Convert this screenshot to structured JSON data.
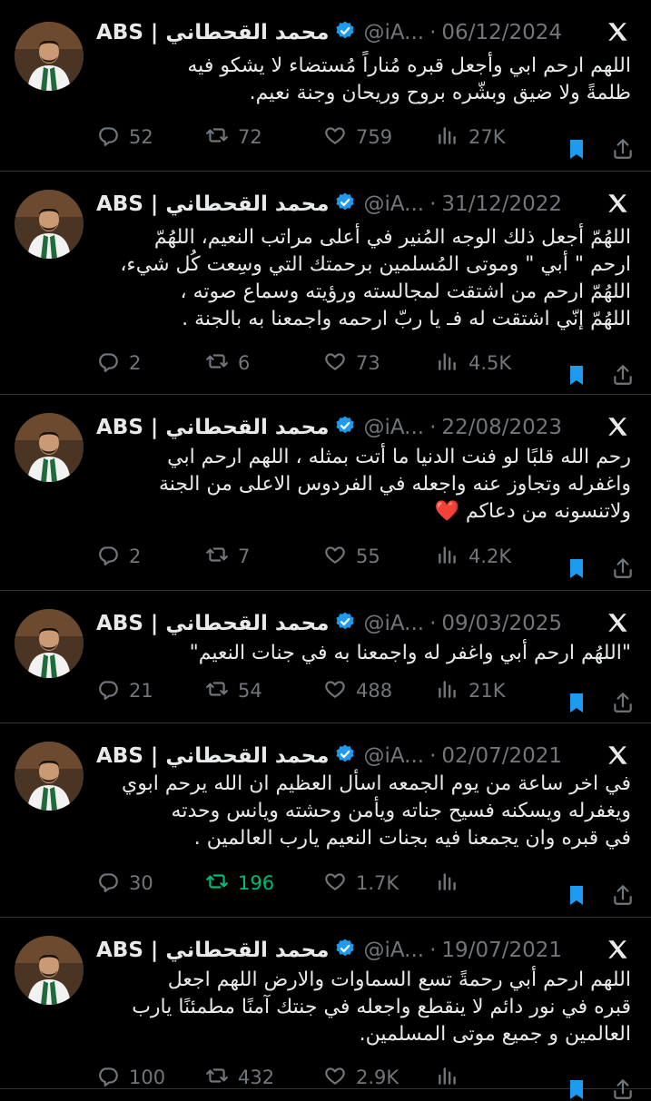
{
  "tweets": [
    {
      "name": "ABS | محمد القحطاني",
      "handle": "@iA...",
      "date": "06/12/2024",
      "lines": [
        "اللهم ارحم ابي وأجعل قبره مُناراً مُستضاء لا يشكو فيه",
        "ظلمةً ولا ضيق وبشّره بروح وريحان وجنة نعيم."
      ],
      "replies": "52",
      "retweets": "72",
      "likes": "759",
      "views": "27K",
      "retweeted": false
    },
    {
      "name": "ABS | محمد القحطاني",
      "handle": "@iA...",
      "date": "31/12/2022",
      "lines": [
        "اللهُمّ أجعل ذلك الوجه المُنير في أعلى مراتب النعيم، اللهُمّ",
        "ارحم \" أبي \" وموتى المُسلمين برحمتك التي وسِعت كُل شيء،",
        "اللهُمّ ارحم من اشتقت لمجالسته ورؤيته وسماع صوته ،",
        "اللهُمّ إنّي اشتقت له فـ يا ربّ ارحمه واجمعنا به بالجنة ."
      ],
      "replies": "2",
      "retweets": "6",
      "likes": "73",
      "views": "4.5K",
      "retweeted": false
    },
    {
      "name": "ABS | محمد القحطاني",
      "handle": "@iA...",
      "date": "22/08/2023",
      "lines": [
        "رحم الله قلبًا لو فنت الدنيا ما أتت بمثله ، اللهم ارحم ابي",
        "واغفرله وتجاوز عنه واجعله في الفردوس الاعلى من الجنة",
        "ولاتنسونه من دعاكم ❤️"
      ],
      "replies": "2",
      "retweets": "7",
      "likes": "55",
      "views": "4.2K",
      "retweeted": false
    },
    {
      "name": "ABS | محمد القحطاني",
      "handle": "@iA...",
      "date": "09/03/2025",
      "lines": [
        "\"اللهُم ارحم أبي واغفر له واجمعنا به في جنات النعيم\""
      ],
      "replies": "21",
      "retweets": "54",
      "likes": "488",
      "views": "21K",
      "retweeted": false
    },
    {
      "name": "ABS | محمد القحطاني",
      "handle": "@iA...",
      "date": "02/07/2021",
      "lines": [
        "في اخر ساعة من يوم الجمعه اسأل العظيم ان الله يرحم ابوي",
        "ويغفرله ويسكنه فسيح جناته ويأمن وحشته ويانس وحدته",
        "في قبره وان يجمعنا فيه بجنات النعيم يارب العالمين ."
      ],
      "replies": "30",
      "retweets": "196",
      "likes": "1.7K",
      "views": "",
      "retweeted": true
    },
    {
      "name": "ABS | محمد القحطاني",
      "handle": "@iA...",
      "date": "19/07/2021",
      "lines": [
        "اللهم ارحم أبي رحمةً تسع السماوات والارض اللهم اجعل",
        "قبره في نور دائم لا ينقطع واجعله في جنتك آمنًا مطمئنًا يارب",
        "العالمين و جميع موتى المسلمين."
      ],
      "replies": "100",
      "retweets": "432",
      "likes": "2.9K",
      "views": "",
      "retweeted": false
    }
  ],
  "colors": {
    "background": "#000000",
    "text": "#e7e9ea",
    "muted": "#71767b",
    "verified": "#1d9bf0",
    "bookmark": "#1d9bf0",
    "retweet_active": "#00ba7c"
  }
}
